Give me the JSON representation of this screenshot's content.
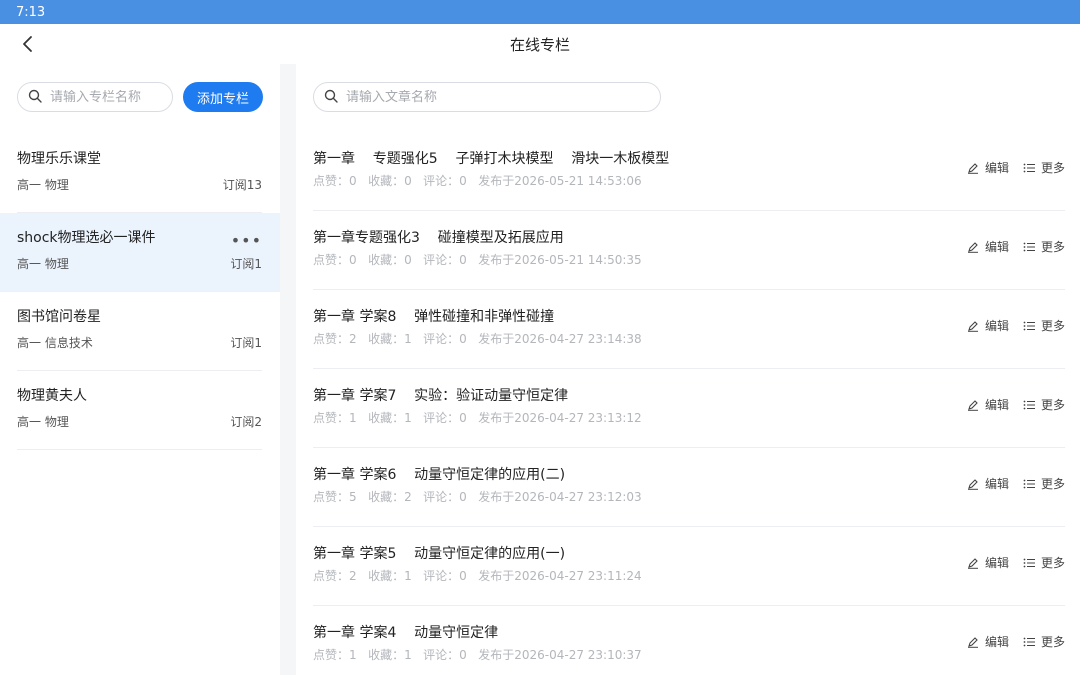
{
  "status_bar": {
    "time": "7:13"
  },
  "header": {
    "title": "在线专栏"
  },
  "left": {
    "search_placeholder": "请输入专栏名称",
    "add_button": "添加专栏",
    "columns": [
      {
        "name": "物理乐乐课堂",
        "subject": "高一 物理",
        "subscriptions": "订阅13"
      },
      {
        "name": "shock物理选必一课件",
        "subject": "高一 物理",
        "subscriptions": "订阅1"
      },
      {
        "name": "图书馆问卷星",
        "subject": "高一 信息技术",
        "subscriptions": "订阅1"
      },
      {
        "name": "物理黄夫人",
        "subject": "高一 物理",
        "subscriptions": "订阅2"
      }
    ]
  },
  "right": {
    "search_placeholder": "请输入文章名称",
    "edit_label": "编辑",
    "more_label": "更多",
    "articles": [
      {
        "title": "第一章    专题强化5    子弹打木块模型    滑块一木板模型",
        "meta": "点赞：0   收藏：0   评论：0   发布于2026-05-21 14:53:06"
      },
      {
        "title": "第一章专题强化3    碰撞模型及拓展应用",
        "meta": "点赞：0   收藏：0   评论：0   发布于2026-05-21 14:50:35"
      },
      {
        "title": "第一章 学案8    弹性碰撞和非弹性碰撞",
        "meta": "点赞：2   收藏：1   评论：0   发布于2026-04-27 23:14:38"
      },
      {
        "title": "第一章 学案7    实验：验证动量守恒定律",
        "meta": "点赞：1   收藏：1   评论：0   发布于2026-04-27 23:13:12"
      },
      {
        "title": "第一章 学案6    动量守恒定律的应用(二)",
        "meta": "点赞：5   收藏：2   评论：0   发布于2026-04-27 23:12:03"
      },
      {
        "title": "第一章 学案5    动量守恒定律的应用(一)",
        "meta": "点赞：2   收藏：1   评论：0   发布于2026-04-27 23:11:24"
      },
      {
        "title": "第一章 学案4    动量守恒定律",
        "meta": "点赞：1   收藏：1   评论：0   发布于2026-04-27 23:10:37"
      }
    ]
  },
  "colors": {
    "status_bar": "#4a90e2",
    "accent": "#1e7bf0",
    "active_row": "#ebf3fd"
  }
}
